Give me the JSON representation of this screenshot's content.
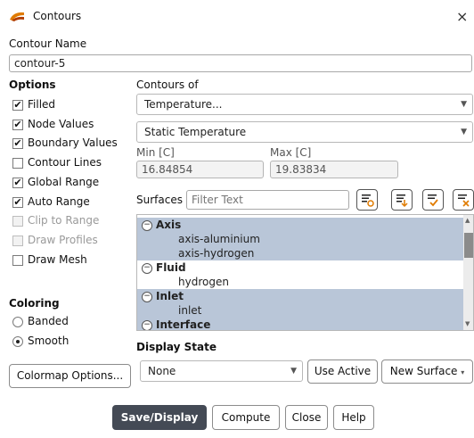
{
  "window": {
    "title": "Contours",
    "close_glyph": "×",
    "app_icon": "fluent-logo-icon"
  },
  "contour_name": {
    "label": "Contour Name",
    "value": "contour-5"
  },
  "options": {
    "heading": "Options",
    "items": [
      {
        "label": "Filled",
        "checked": true,
        "enabled": true
      },
      {
        "label": "Node Values",
        "checked": true,
        "enabled": true
      },
      {
        "label": "Boundary Values",
        "checked": true,
        "enabled": true
      },
      {
        "label": "Contour Lines",
        "checked": false,
        "enabled": true
      },
      {
        "label": "Global Range",
        "checked": true,
        "enabled": true
      },
      {
        "label": "Auto Range",
        "checked": true,
        "enabled": true
      },
      {
        "label": "Clip to Range",
        "checked": false,
        "enabled": false
      },
      {
        "label": "Draw Profiles",
        "checked": false,
        "enabled": false
      },
      {
        "label": "Draw Mesh",
        "checked": false,
        "enabled": true
      }
    ]
  },
  "contours_of": {
    "label": "Contours of",
    "primary": "Temperature...",
    "secondary": "Static Temperature",
    "min_label": "Min [C]",
    "max_label": "Max [C]",
    "min_value": "16.84854",
    "max_value": "19.83834"
  },
  "surfaces": {
    "label": "Surfaces",
    "filter_placeholder": "Filter Text",
    "tool_icons": [
      "filter-surfaces-icon",
      "select-all-surfaces-icon",
      "apply-selection-icon",
      "clear-selection-icon"
    ],
    "groups": [
      {
        "name": "Axis",
        "selected": true,
        "items": [
          {
            "name": "axis-aluminium",
            "selected": true
          },
          {
            "name": "axis-hydrogen",
            "selected": true
          }
        ]
      },
      {
        "name": "Fluid",
        "selected": false,
        "items": [
          {
            "name": "hydrogen",
            "selected": false
          }
        ]
      },
      {
        "name": "Inlet",
        "selected": true,
        "items": [
          {
            "name": "inlet",
            "selected": true
          }
        ]
      },
      {
        "name": "Interface",
        "selected": true,
        "items": []
      }
    ]
  },
  "coloring": {
    "heading": "Coloring",
    "options": [
      "Banded",
      "Smooth"
    ],
    "selected": "Smooth"
  },
  "display_state": {
    "label": "Display State",
    "value": "None",
    "use_active": "Use Active",
    "new_surface": "New Surface"
  },
  "buttons": {
    "colormap": "Colormap Options...",
    "save_display": "Save/Display",
    "compute": "Compute",
    "close": "Close",
    "help": "Help"
  },
  "colors": {
    "selection": "#b9c6d8",
    "primary_button": "#444a55",
    "accent_orange": "#e07b00"
  }
}
